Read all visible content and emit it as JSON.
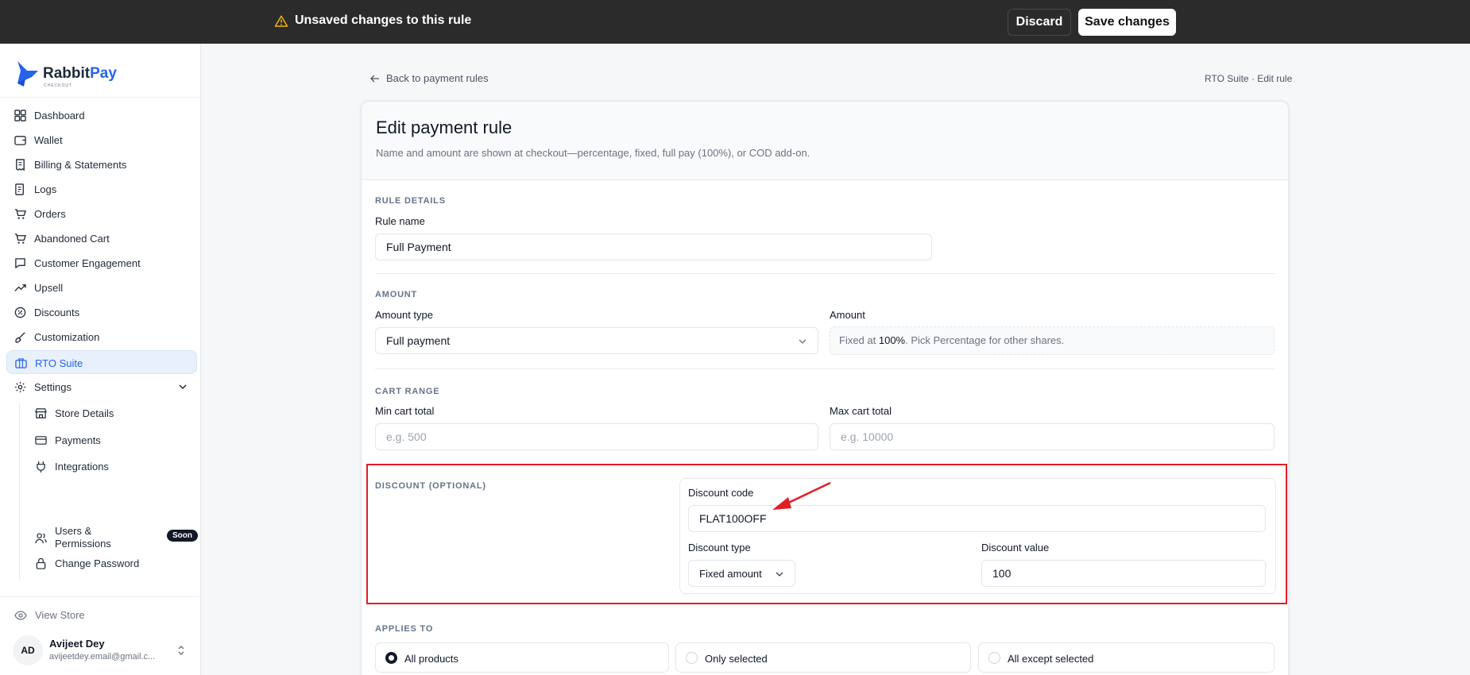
{
  "topbar": {
    "message": "Unsaved changes to this rule",
    "discard_label": "Discard",
    "save_label": "Save changes"
  },
  "sidebar": {
    "brand_a": "Rabbit",
    "brand_b": "Pay",
    "brand_sub": "CHECKOUT",
    "items": [
      {
        "label": "Dashboard",
        "icon": "dashboard-icon"
      },
      {
        "label": "Wallet",
        "icon": "wallet-icon"
      },
      {
        "label": "Billing & Statements",
        "icon": "receipt-icon"
      },
      {
        "label": "Logs",
        "icon": "logs-icon"
      },
      {
        "label": "Orders",
        "icon": "cart-icon"
      },
      {
        "label": "Abandoned Cart",
        "icon": "cart-icon"
      },
      {
        "label": "Customer Engagement",
        "icon": "chat-icon"
      },
      {
        "label": "Upsell",
        "icon": "trending-up-icon"
      },
      {
        "label": "Discounts",
        "icon": "discount-icon"
      },
      {
        "label": "Customization",
        "icon": "brush-icon"
      },
      {
        "label": "RTO Suite",
        "icon": "suitcase-icon",
        "active": true
      },
      {
        "label": "Settings",
        "icon": "gear-icon",
        "expanded": true
      }
    ],
    "settings_items": [
      {
        "label": "Store Details",
        "icon": "store-icon"
      },
      {
        "label": "Payments",
        "icon": "card-icon"
      },
      {
        "label": "Integrations",
        "icon": "plug-icon"
      },
      {
        "label": "Users &\nPermissions",
        "icon": "users-icon",
        "badge": "Soon"
      },
      {
        "label": "Change Password",
        "icon": "lock-icon"
      }
    ],
    "view_store": "View Store",
    "user": {
      "initials": "AD",
      "name": "Avijeet Dey",
      "email": "avijeetdey.email@gmail.c..."
    }
  },
  "main": {
    "back_label": "Back to payment rules",
    "breadcrumb": "RTO Suite · Edit rule",
    "title": "Edit payment rule",
    "description": "Name and amount are shown at checkout—percentage, fixed, full pay (100%), or COD add-on.",
    "rule_details": {
      "section": "RULE DETAILS",
      "name_label": "Rule name",
      "name_value": "Full Payment"
    },
    "amount": {
      "section": "AMOUNT",
      "type_label": "Amount type",
      "type_value": "Full payment",
      "amount_label": "Amount",
      "note_prefix": "Fixed at ",
      "note_bold": "100%",
      "note_suffix": ". Pick Percentage for other shares."
    },
    "cart_range": {
      "section": "CART RANGE",
      "min_label": "Min cart total",
      "min_placeholder": "e.g. 500",
      "max_label": "Max cart total",
      "max_placeholder": "e.g. 10000"
    },
    "discount": {
      "section": "DISCOUNT (OPTIONAL)",
      "code_label": "Discount code",
      "code_value": "FLAT100OFF",
      "type_label": "Discount type",
      "type_value": "Fixed amount",
      "value_label": "Discount value",
      "value_value": "100"
    },
    "applies_to": {
      "section": "APPLIES TO",
      "options": [
        "All products",
        "Only selected",
        "All except selected"
      ],
      "selected": "All products"
    }
  },
  "colors": {
    "accent": "#2563eb",
    "topbar": "#2b2b2b",
    "highlight": "#e11d26"
  }
}
